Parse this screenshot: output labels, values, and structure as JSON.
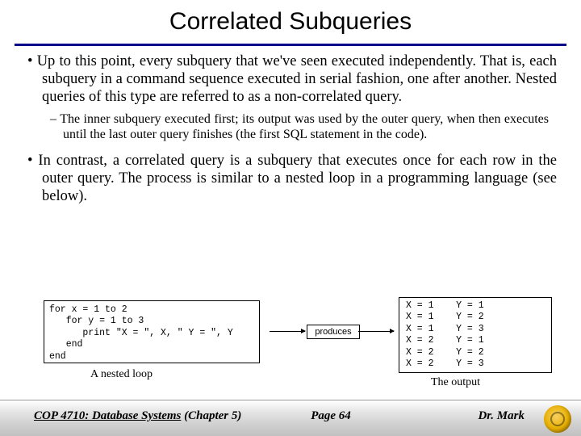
{
  "title": "Correlated Subqueries",
  "bullets": {
    "b1": "Up to this point, every subquery that we've seen executed independently.  That is, each subquery in a command sequence executed in serial fashion, one after another.   Nested queries of this type are referred to as a non-correlated query.",
    "s1": "The inner subquery executed first; its output was used by the outer query, when then executes until the last outer query finishes (the first SQL statement in the code).",
    "b2": "In contrast, a correlated query is a subquery that executes once for each row in the outer query.  The process is similar to a nested loop in a programming language (see below)."
  },
  "code": "for x = 1 to 2\n   for y = 1 to 3\n      print \"X = \", X, \" Y = \", Y\n   end\nend",
  "produces_label": "produces",
  "output": "X = 1    Y = 1\nX = 1    Y = 2\nX = 1    Y = 3\nX = 2    Y = 1\nX = 2    Y = 2\nX = 2    Y = 3",
  "caption_left": "A nested loop",
  "caption_right": "The output",
  "footer": {
    "course": "COP 4710: Database Systems",
    "chapter": "(Chapter 5)",
    "page": "Page 64",
    "author": "Dr. Mark"
  }
}
